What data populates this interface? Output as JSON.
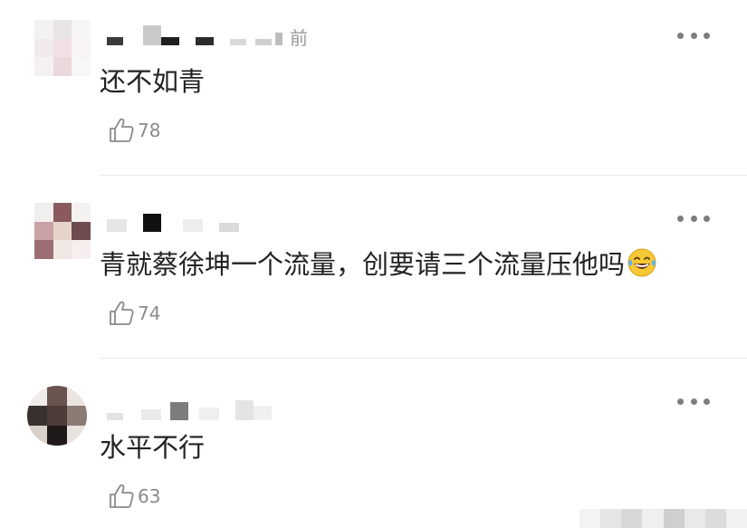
{
  "comments": [
    {
      "time_suffix": "前",
      "text": "还不如青",
      "emoji": "",
      "likes": "78",
      "more_icon": "more-icon"
    },
    {
      "time_suffix": "",
      "text": "青就蔡徐坤一个流量，创要请三个流量压他吗",
      "emoji": "face-with-tears-of-joy",
      "likes": "74",
      "more_icon": "more-icon"
    },
    {
      "time_suffix": "",
      "text": "水平不行",
      "emoji": "",
      "likes": "63",
      "more_icon": "more-icon"
    }
  ],
  "icons": {
    "like": "thumbs-up-outline-icon",
    "more": "horizontal-ellipsis-icon",
    "emoji": "tears-of-joy-emoji-icon"
  }
}
